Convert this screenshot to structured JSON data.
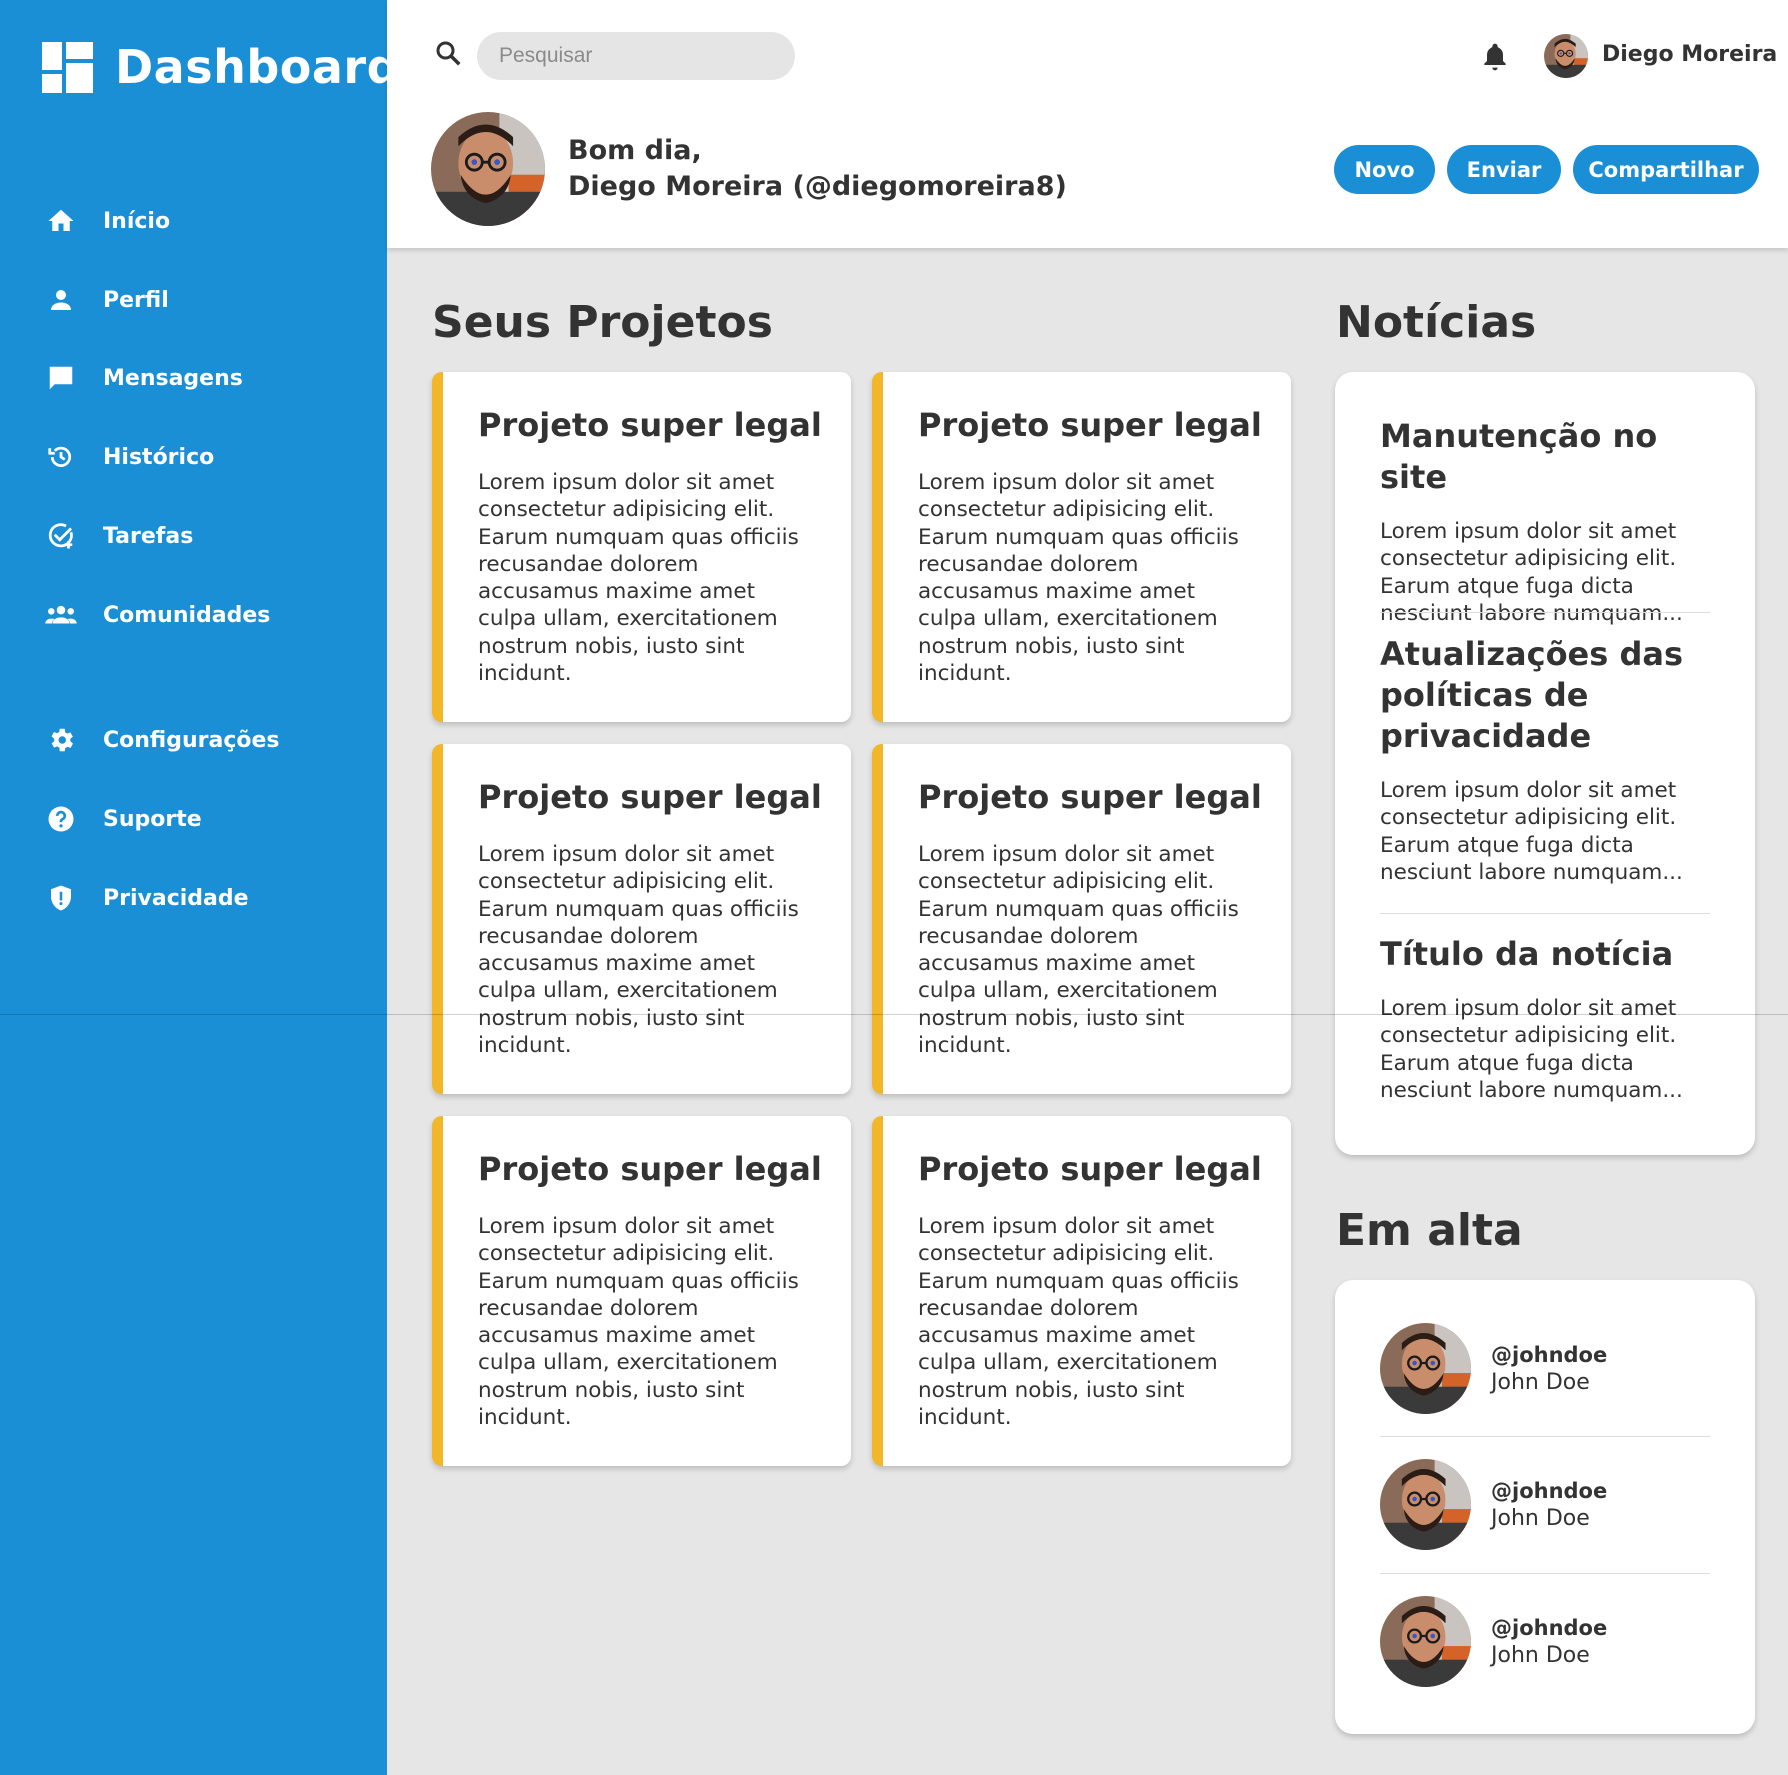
{
  "colors": {
    "accent": "#1a8fd6",
    "card_stripe": "#f2b629",
    "background": "#e6e6e6"
  },
  "sidebar": {
    "brand": "Dashboard",
    "items": [
      {
        "label": "Início",
        "icon": "home-icon"
      },
      {
        "label": "Perfil",
        "icon": "person-icon"
      },
      {
        "label": "Mensagens",
        "icon": "chat-icon"
      },
      {
        "label": "Histórico",
        "icon": "history-icon"
      },
      {
        "label": "Tarefas",
        "icon": "task-check-icon"
      },
      {
        "label": "Comunidades",
        "icon": "group-icon"
      },
      {
        "label": "Configurações",
        "icon": "gear-icon"
      },
      {
        "label": "Suporte",
        "icon": "help-icon"
      },
      {
        "label": "Privacidade",
        "icon": "shield-icon"
      }
    ]
  },
  "header": {
    "search_placeholder": "Pesquisar",
    "user_name": "Diego Moreira",
    "greeting_line1": "Bom dia,",
    "greeting_line2": "Diego Moreira (@diegomoreira8)",
    "buttons": {
      "new": "Novo",
      "send": "Enviar",
      "share": "Compartilhar"
    }
  },
  "projects": {
    "title": "Seus Projetos",
    "cards": [
      {
        "title": "Projeto super legal",
        "text": "Lorem ipsum dolor sit amet consectetur adipisicing elit. Earum numquam quas officiis recusandae dolorem accusamus maxime amet culpa ullam, exercitationem nostrum nobis, iusto sint incidunt."
      },
      {
        "title": "Projeto super legal",
        "text": "Lorem ipsum dolor sit amet consectetur adipisicing elit. Earum numquam quas officiis recusandae dolorem accusamus maxime amet culpa ullam, exercitationem nostrum nobis, iusto sint incidunt."
      },
      {
        "title": "Projeto super legal",
        "text": "Lorem ipsum dolor sit amet consectetur adipisicing elit. Earum numquam quas officiis recusandae dolorem accusamus maxime amet culpa ullam, exercitationem nostrum nobis, iusto sint incidunt."
      },
      {
        "title": "Projeto super legal",
        "text": "Lorem ipsum dolor sit amet consectetur adipisicing elit. Earum numquam quas officiis recusandae dolorem accusamus maxime amet culpa ullam, exercitationem nostrum nobis, iusto sint incidunt."
      },
      {
        "title": "Projeto super legal",
        "text": "Lorem ipsum dolor sit amet consectetur adipisicing elit. Earum numquam quas officiis recusandae dolorem accusamus maxime amet culpa ullam, exercitationem nostrum nobis, iusto sint incidunt."
      },
      {
        "title": "Projeto super legal",
        "text": "Lorem ipsum dolor sit amet consectetur adipisicing elit. Earum numquam quas officiis recusandae dolorem accusamus maxime amet culpa ullam, exercitationem nostrum nobis, iusto sint incidunt."
      }
    ]
  },
  "news": {
    "title": "Notícias",
    "items": [
      {
        "title": "Manutenção no site",
        "text": "Lorem ipsum dolor sit amet consectetur adipisicing elit. Earum atque fuga dicta nesciunt labore numquam..."
      },
      {
        "title": "Atualizações das políticas de privacidade",
        "text": "Lorem ipsum dolor sit amet consectetur adipisicing elit. Earum atque fuga dicta nesciunt labore numquam..."
      },
      {
        "title": "Título da notícia",
        "text": "Lorem ipsum dolor sit amet consectetur adipisicing elit. Earum atque fuga dicta nesciunt labore numquam..."
      }
    ]
  },
  "trending": {
    "title": "Em alta",
    "users": [
      {
        "handle": "@johndoe",
        "name": "John Doe"
      },
      {
        "handle": "@johndoe",
        "name": "John Doe"
      },
      {
        "handle": "@johndoe",
        "name": "John Doe"
      }
    ]
  }
}
